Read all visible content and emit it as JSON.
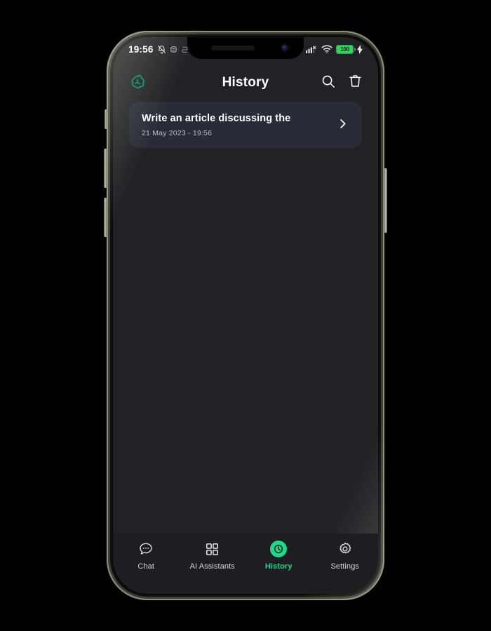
{
  "status_bar": {
    "time": "19:56",
    "battery_level": "100",
    "icons": [
      "bell-muted-icon",
      "notification-badge-icon",
      "notification-badge-icon",
      "signal-bars-off-icon",
      "wifi-icon",
      "battery-icon",
      "charging-bolt-icon"
    ]
  },
  "header": {
    "title": "History",
    "logo": "chatgpt-logo",
    "search_icon": "search-icon",
    "delete_icon": "trash-icon"
  },
  "history": {
    "items": [
      {
        "title": "Write an article discussing the",
        "date": "21 May 2023 - 19:56",
        "chevron": "chevron-right-icon"
      }
    ]
  },
  "tabs": [
    {
      "label": "Chat",
      "icon": "chat-bubble-icon",
      "active": false
    },
    {
      "label": "AI Assistants",
      "icon": "grid-squares-icon",
      "active": false
    },
    {
      "label": "History",
      "icon": "clock-icon",
      "active": true
    },
    {
      "label": "Settings",
      "icon": "gear-icon",
      "active": false
    }
  ],
  "colors": {
    "accent": "#1fd98a",
    "background": "#212126",
    "card": "#272c37",
    "tabbar": "#1d1d22",
    "battery": "#2fd45f"
  }
}
